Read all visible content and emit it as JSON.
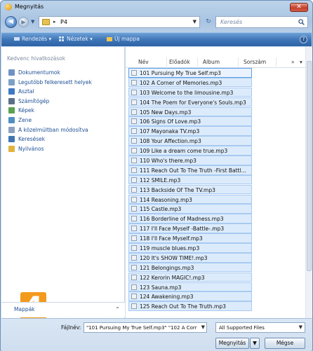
{
  "window": {
    "title": "Megnyitás"
  },
  "address": {
    "path_segment": "P4",
    "separator": "▸"
  },
  "search": {
    "placeholder": "Keresés"
  },
  "toolbar": {
    "organize_label": "Rendezés",
    "views_label": "Nézetek",
    "new_folder_label": "Új mappa",
    "help_label": "?"
  },
  "nav": {
    "header": "Kedvenc hivatkozások",
    "items": [
      {
        "label": "Dokumentumok",
        "icon": "documents-icon"
      },
      {
        "label": "Legutóbb felkeresett helyek",
        "icon": "recent-places-icon"
      },
      {
        "label": "Asztal",
        "icon": "desktop-icon"
      },
      {
        "label": "Számítógép",
        "icon": "computer-icon"
      },
      {
        "label": "Képek",
        "icon": "pictures-icon"
      },
      {
        "label": "Zene",
        "icon": "music-icon"
      },
      {
        "label": "A közelmúltban módosítva",
        "icon": "recently-changed-icon"
      },
      {
        "label": "Keresések",
        "icon": "searches-icon"
      },
      {
        "label": "Nyilvános",
        "icon": "public-icon"
      }
    ],
    "folders_label": "Mappák",
    "badge": "4"
  },
  "columns": {
    "name": "Név",
    "artist": "Előadók",
    "album": "Album",
    "track": "Sorszám",
    "more": "»"
  },
  "files": [
    "101 Pursuing My True Self.mp3",
    "102 A Corner of Memories.mp3",
    "103 Welcome to the limousine.mp3",
    "104 The Poem for Everyone's Souls.mp3",
    "105 New Days.mp3",
    "106 Signs Of Love.mp3",
    "107 Mayonaka TV.mp3",
    "108 Your Affection.mp3",
    "109 Like a dream come true.mp3",
    "110 Who's there.mp3",
    "111 Reach Out To The Truth -First Battl...",
    "112 SMILE.mp3",
    "113 Backside Of The TV.mp3",
    "114 Reasoning.mp3",
    "115 Castle.mp3",
    "116 Borderline of Madness.mp3",
    "117 I'll Face Myself -Battle-.mp3",
    "118 I'll Face Myself.mp3",
    "119 muscle blues.mp3",
    "120 It's SHOW TIME!.mp3",
    "121 Belongings.mp3",
    "122 Kerorin MAGIC!.mp3",
    "123 Sauna.mp3",
    "124 Awakening.mp3",
    "125 Reach Out To The Truth.mp3"
  ],
  "footer": {
    "filename_label": "Fájlnév:",
    "filename_value": "\"101 Pursuing My True Self.mp3\" \"102 A Corr",
    "filetype_value": "All Supported Files",
    "open_label": "Megnyitás",
    "cancel_label": "Mégse"
  },
  "colors": {
    "toolbar": "#3f76b8",
    "selection": "#dcebfb",
    "link": "#1d4f95",
    "badge": "#f39a1c"
  }
}
